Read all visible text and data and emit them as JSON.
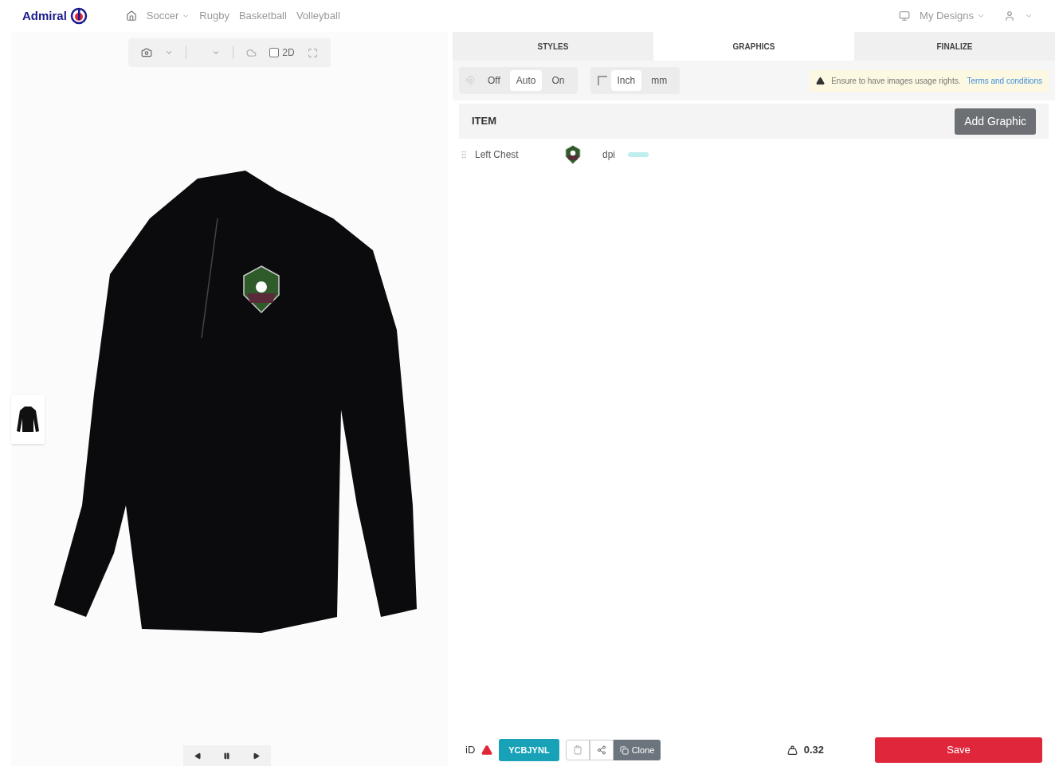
{
  "nav": {
    "brand": "Admiral",
    "links": [
      {
        "label": "Soccer",
        "dropdown": true
      },
      {
        "label": "Rugby",
        "dropdown": false
      },
      {
        "label": "Basketball",
        "dropdown": false
      },
      {
        "label": "Volleyball",
        "dropdown": false
      }
    ],
    "my_designs": "My Designs"
  },
  "viewer": {
    "toggle_2d": {
      "label": "2D",
      "checked": false
    }
  },
  "tabs": [
    {
      "label": "STYLES",
      "selected": false
    },
    {
      "label": "GRAPHICS",
      "selected": true
    },
    {
      "label": "FINALIZE",
      "selected": false
    }
  ],
  "snap": [
    {
      "label": "Off",
      "selected": false
    },
    {
      "label": "Auto",
      "selected": true
    },
    {
      "label": "On",
      "selected": false
    }
  ],
  "units": [
    {
      "label": "Inch",
      "selected": true
    },
    {
      "label": "mm",
      "selected": false
    }
  ],
  "notice": {
    "text": "Ensure to have images usage rights.",
    "link": "Terms and conditions"
  },
  "section": {
    "title": "ITEM",
    "button": "Add Graphic"
  },
  "graphics": [
    {
      "location": "Left Chest",
      "unit": "dpi"
    }
  ],
  "footer": {
    "id_label": "iD",
    "code": "YCBJYNL",
    "clone": "Clone",
    "weight": "0.32",
    "save": "Save"
  }
}
